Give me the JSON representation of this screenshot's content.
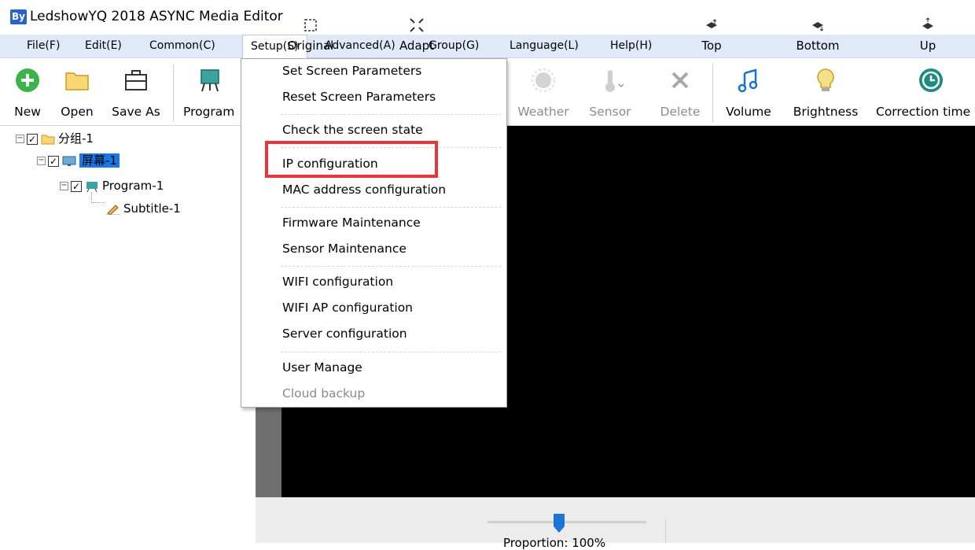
{
  "window": {
    "title": "LedshowYQ 2018 ASYNC Media Editor",
    "icon": "app-logo"
  },
  "menubar": {
    "items": [
      {
        "label": "File(F)"
      },
      {
        "label": "Edit(E)"
      },
      {
        "label": "Common(C)"
      },
      {
        "label": "Setup(S)",
        "open": true
      },
      {
        "label": "Advanced(A)"
      },
      {
        "label": "Group(G)"
      },
      {
        "label": "Language(L)"
      },
      {
        "label": "Help(H)"
      }
    ]
  },
  "toolbar": {
    "items": [
      {
        "label": "New",
        "icon": "plus-circle-icon"
      },
      {
        "label": "Open",
        "icon": "folder-icon"
      },
      {
        "label": "Save As",
        "icon": "briefcase-icon"
      },
      {
        "label": "Program",
        "icon": "easel-icon"
      },
      {
        "label": "Weather",
        "icon": "sun-icon",
        "disabled": true
      },
      {
        "label": "Sensor",
        "icon": "thermometer-icon",
        "disabled": true
      },
      {
        "label": "Delete",
        "icon": "x-icon",
        "disabled": true
      },
      {
        "label": "Volume",
        "icon": "music-note-icon"
      },
      {
        "label": "Brightness",
        "icon": "lightbulb-icon"
      },
      {
        "label": "Correction time",
        "icon": "clock-icon"
      }
    ]
  },
  "tree": {
    "nodes": [
      {
        "label": "分组-1",
        "checked": true,
        "icon": "folder-icon"
      },
      {
        "label": "屏幕-1",
        "checked": true,
        "icon": "monitor-icon",
        "selected": true
      },
      {
        "label": "Program-1",
        "checked": true,
        "icon": "easel-icon"
      },
      {
        "label": "Subtitle-1",
        "icon": "pencil-icon"
      }
    ]
  },
  "setup_menu": {
    "items": [
      {
        "label": "Set Screen Parameters"
      },
      {
        "label": "Reset Screen Parameters"
      },
      {
        "label": "Check the screen state"
      },
      {
        "label": "IP configuration",
        "highlighted": true
      },
      {
        "label": "MAC address configuration"
      },
      {
        "label": "Firmware Maintenance"
      },
      {
        "label": "Sensor Maintenance"
      },
      {
        "label": "WIFI configuration"
      },
      {
        "label": "WIFI AP configuration"
      },
      {
        "label": "Server configuration"
      },
      {
        "label": "User Manage"
      },
      {
        "label": "Cloud backup",
        "disabled": true
      }
    ]
  },
  "bottombar": {
    "items": [
      {
        "label": "Original",
        "icon": "original-size-icon"
      },
      {
        "label": "Adapt",
        "icon": "fit-icon"
      },
      {
        "label": "Top",
        "icon": "layer-top-icon"
      },
      {
        "label": "Bottom",
        "icon": "layer-bottom-icon"
      },
      {
        "label": "Up",
        "icon": "layer-up-icon"
      }
    ],
    "zoom_label": "Proportion: 100%",
    "zoom_level": 0.45
  },
  "colors": {
    "menubar": "#dfe9f8",
    "selection": "#1778e6",
    "highlight_box": "#e8363b",
    "canvas": "#000000"
  }
}
